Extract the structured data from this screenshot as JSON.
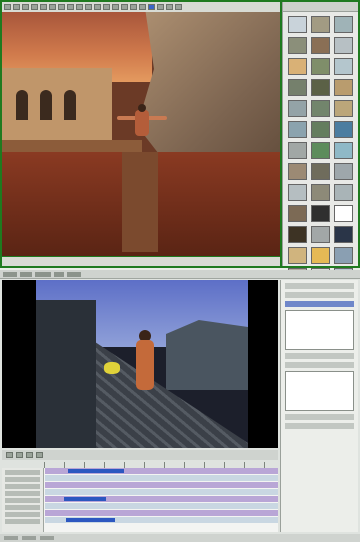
{
  "top_editor": {
    "toolbar_buttons": [
      "tool",
      "tool",
      "tool",
      "tool",
      "tool",
      "tool",
      "tool",
      "tool",
      "tool",
      "tool",
      "tool",
      "tool",
      "tool",
      "tool",
      "tool",
      "tool",
      "tool",
      "tool",
      "tool",
      "tool"
    ],
    "texture_swatches": [
      "#c9d3da",
      "#a29b83",
      "#9fb3b7",
      "#8b8f7a",
      "#8a6f55",
      "#b7c0c4",
      "#d9b176",
      "#7f8e6a",
      "#b4c6cd",
      "#75806c",
      "#5b6146",
      "#b99c6e",
      "#94a3a7",
      "#72856c",
      "#bba67a",
      "#8ba3ae",
      "#647d5e",
      "#4b7da0",
      "#a1a7a5",
      "#5d8c5c",
      "#8fb9c7",
      "#9c8a74",
      "#6f6c5c",
      "#9ea7ab",
      "#b5bec1",
      "#8d8a78",
      "#a9b4b7",
      "#7c6a55",
      "#2f2f2f",
      "#ffffff",
      "#3d3324",
      "#a2a7a7",
      "#2a3548",
      "#d0b47e",
      "#e5b955",
      "#8a9fb2",
      "#b3aaa0",
      "#d9dbdb",
      "#b9c6d0"
    ]
  },
  "bottom_editor": {
    "tracks": [
      {
        "clip_start": 0.1,
        "clip_width": 0.24
      },
      {
        "clip_start": null,
        "clip_width": 0
      },
      {
        "clip_start": null,
        "clip_width": 0
      },
      {
        "clip_start": null,
        "clip_width": 0
      },
      {
        "clip_start": 0.08,
        "clip_width": 0.18
      },
      {
        "clip_start": null,
        "clip_width": 0
      },
      {
        "clip_start": null,
        "clip_width": 0
      },
      {
        "clip_start": 0.09,
        "clip_width": 0.21
      }
    ]
  }
}
